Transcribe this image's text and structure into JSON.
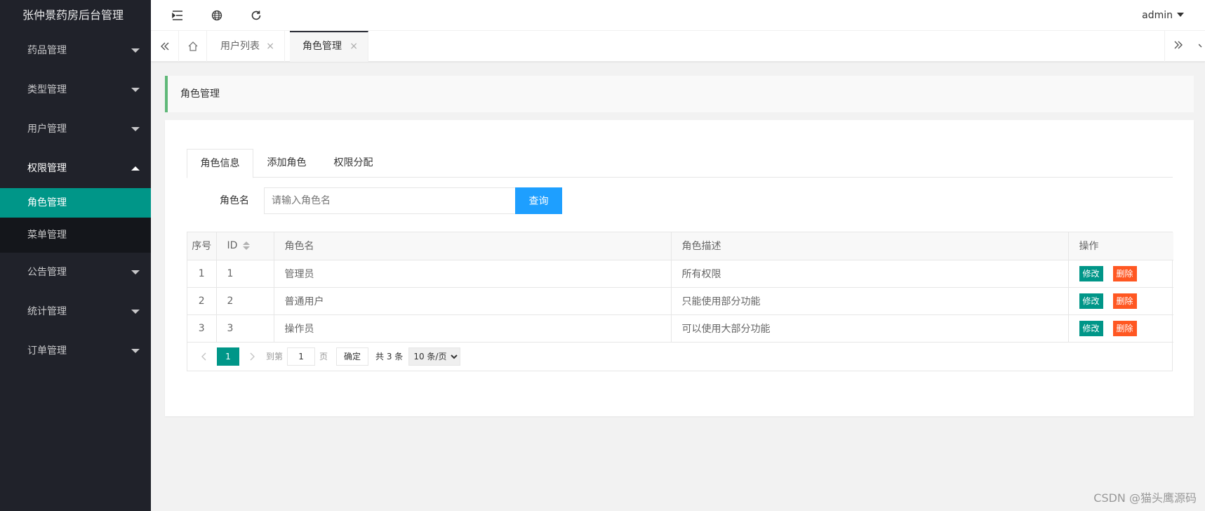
{
  "app": {
    "title": "张仲景药房后台管理"
  },
  "sidebar": {
    "items": [
      {
        "label": "药品管理"
      },
      {
        "label": "类型管理"
      },
      {
        "label": "用户管理"
      },
      {
        "label": "权限管理",
        "open": true,
        "children": [
          {
            "label": "角色管理",
            "active": true
          },
          {
            "label": "菜单管理"
          }
        ]
      },
      {
        "label": "公告管理"
      },
      {
        "label": "统计管理"
      },
      {
        "label": "订单管理"
      }
    ]
  },
  "header": {
    "icons": [
      "menu-fold-icon",
      "globe-icon",
      "refresh-icon"
    ],
    "user": "admin"
  },
  "tabbar": {
    "tabs": [
      {
        "label": "用户列表",
        "close": "×"
      },
      {
        "label": "角色管理",
        "close": "×",
        "active": true
      }
    ]
  },
  "breadcrumb": {
    "title": "角色管理"
  },
  "tabs": [
    {
      "label": "角色信息",
      "active": true
    },
    {
      "label": "添加角色"
    },
    {
      "label": "权限分配"
    }
  ],
  "search": {
    "label": "角色名",
    "placeholder": "请输入角色名",
    "value": "",
    "button": "查询"
  },
  "table": {
    "headers": {
      "index": "序号",
      "id": "ID",
      "name": "角色名",
      "desc": "角色描述",
      "ops": "操作"
    },
    "rows": [
      {
        "index": "1",
        "id": "1",
        "name": "管理员",
        "desc": "所有权限"
      },
      {
        "index": "2",
        "id": "2",
        "name": "普通用户",
        "desc": "只能使用部分功能"
      },
      {
        "index": "3",
        "id": "3",
        "name": "操作员",
        "desc": "可以使用大部分功能"
      }
    ],
    "edit_label": "修改",
    "delete_label": "删除"
  },
  "pager": {
    "current": "1",
    "goto_prefix": "到第",
    "goto_value": "1",
    "goto_suffix": "页",
    "confirm": "确定",
    "total": "共 3 条",
    "page_size": "10 条/页"
  },
  "watermark": "CSDN @猫头鹰源码",
  "colors": {
    "sidebar": "#20222a",
    "accent": "#009688",
    "primary": "#1e9fff",
    "danger": "#ff5722",
    "breadcrumb_bar": "#5fb878"
  }
}
